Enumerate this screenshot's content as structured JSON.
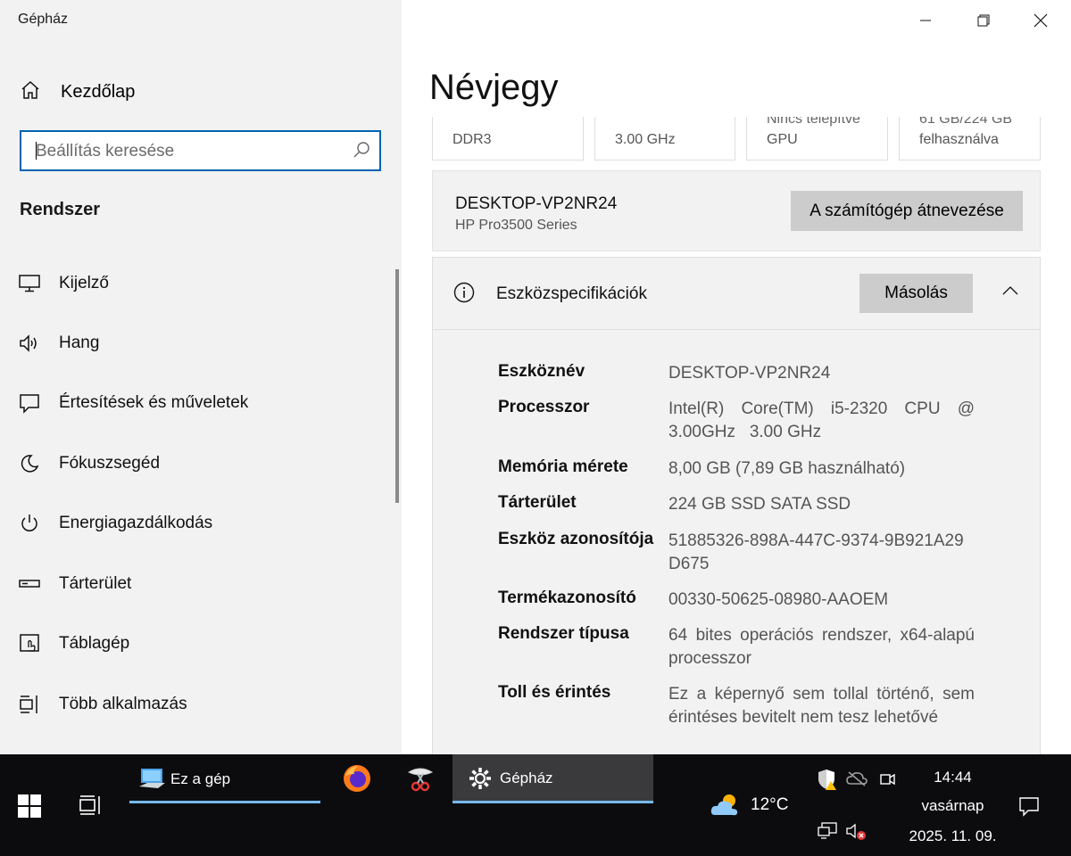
{
  "window": {
    "app_title": "Gépház"
  },
  "sidebar": {
    "home_label": "Kezdőlap",
    "search_placeholder": "Beállítás keresése",
    "section": "Rendszer",
    "items": [
      {
        "label": "Kijelző",
        "icon": "monitor-icon"
      },
      {
        "label": "Hang",
        "icon": "speaker-icon"
      },
      {
        "label": "Értesítések és műveletek",
        "icon": "notification-icon"
      },
      {
        "label": "Fókuszsegéd",
        "icon": "moon-icon"
      },
      {
        "label": "Energiagazdálkodás",
        "icon": "power-icon"
      },
      {
        "label": "Tárterület",
        "icon": "storage-icon"
      },
      {
        "label": "Táblagép",
        "icon": "tablet-icon"
      },
      {
        "label": "Több alkalmazás",
        "icon": "multitask-icon"
      }
    ]
  },
  "main": {
    "title": "Névjegy",
    "tiles": [
      {
        "line1": "",
        "line2": "DDR3"
      },
      {
        "line1": "",
        "line2": "3.00 GHz"
      },
      {
        "line1": "Nincs telepítve",
        "line2": "GPU"
      },
      {
        "line1": "61 GB/224 GB",
        "line2": "felhasználva"
      }
    ],
    "pc_name": "DESKTOP-VP2NR24",
    "pc_model": "HP Pro3500 Series",
    "rename_button": "A számítógép átnevezése",
    "spec_title": "Eszközspecifikációk",
    "copy_button": "Másolás",
    "specs": [
      {
        "key": "Eszköznév",
        "value": "DESKTOP-VP2NR24"
      },
      {
        "key": "Processzor",
        "value": "Intel(R) Core(TM) i5-2320 CPU @ 3.00GHz   3.00 GHz"
      },
      {
        "key": "Memória mérete",
        "value": "8,00 GB (7,89 GB használható)"
      },
      {
        "key": "Tárterület",
        "value": "224 GB SSD SATA SSD"
      },
      {
        "key": "Eszköz azonosítója",
        "value": "51885326-898A-447C-9374-9B921A29D675"
      },
      {
        "key": "Termékazonosító",
        "value": "00330-50625-08980-AAOEM"
      },
      {
        "key": "Rendszer típusa",
        "value": "64 bites operációs rendszer, x64-alapú processzor"
      },
      {
        "key": "Toll és érintés",
        "value": "Ez a képernyő sem tollal történő, sem érintéses bevitelt nem tesz lehetővé"
      }
    ]
  },
  "taskbar": {
    "explorer_label": "Ez a gép",
    "settings_label": "Gépház",
    "weather_temp": "12°C",
    "time": "14:44",
    "day": "vasárnap",
    "date": "2025. 11. 09.",
    "accent": "#76b9ed"
  }
}
